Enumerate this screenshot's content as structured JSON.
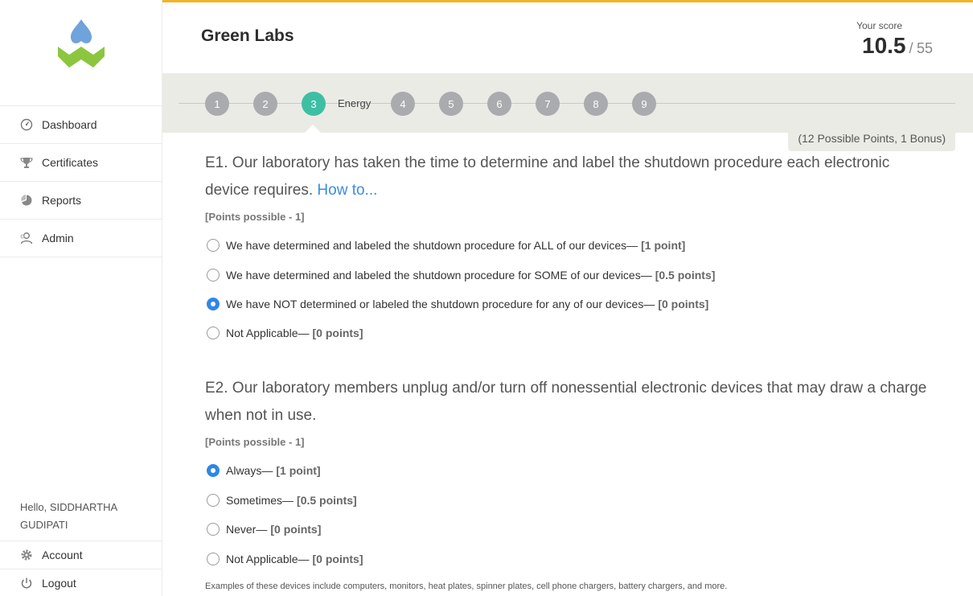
{
  "sidebar": {
    "nav": [
      {
        "label": "Dashboard",
        "icon": "dashboard-icon"
      },
      {
        "label": "Certificates",
        "icon": "trophy-icon"
      },
      {
        "label": "Reports",
        "icon": "pie-chart-icon"
      },
      {
        "label": "Admin",
        "icon": "users-icon"
      }
    ],
    "greeting_prefix": "Hello,",
    "user_name": "SIDDHARTHA GUDIPATI",
    "account_label": "Account",
    "logout_label": "Logout"
  },
  "header": {
    "title": "Green Labs",
    "score_label": "Your score",
    "score_value": "10.5",
    "score_separator": "/",
    "score_max": "55"
  },
  "steps": {
    "items": [
      "1",
      "2",
      "3",
      "4",
      "5",
      "6",
      "7",
      "8",
      "9"
    ],
    "active_index": 2,
    "active_label": "Energy"
  },
  "section": {
    "possible_points": "(12 Possible Points, 1 Bonus)"
  },
  "questions": [
    {
      "text": "E1. Our laboratory has taken the time to determine and label the shutdown procedure each electronic device requires.",
      "link": "How to...",
      "points_possible": "[Points possible - 1]",
      "options": [
        {
          "label": "We have determined and labeled the shutdown procedure for ALL of our devices—",
          "points": "[1 point]",
          "checked": false
        },
        {
          "label": "We have determined and labeled the shutdown procedure for SOME of our devices—",
          "points": "[0.5 points]",
          "checked": false
        },
        {
          "label": "We have NOT determined or labeled the shutdown procedure for any of our devices—",
          "points": "[0 points]",
          "checked": true
        },
        {
          "label": "Not Applicable—",
          "points": "[0 points]",
          "checked": false
        }
      ]
    },
    {
      "text": "E2. Our laboratory members unplug and/or turn off nonessential electronic devices that may draw a charge when not in use.",
      "points_possible": "[Points possible - 1]",
      "options": [
        {
          "label": "Always—",
          "points": "[1 point]",
          "checked": true
        },
        {
          "label": "Sometimes—",
          "points": "[0.5 points]",
          "checked": false
        },
        {
          "label": "Never—",
          "points": "[0 points]",
          "checked": false
        },
        {
          "label": "Not Applicable—",
          "points": "[0 points]",
          "checked": false
        }
      ],
      "note": "Examples of these devices include computers, monitors, heat plates, spinner plates, cell phone chargers, battery chargers, and more."
    }
  ],
  "colors": {
    "accent_top": "#f5b325",
    "step_active": "#3ebfa4",
    "step_inactive": "#a9abaf",
    "radio_checked": "#2f86e8",
    "link": "#3a8dde",
    "logo_blue": "#6fa3d9",
    "logo_green": "#8cc63f"
  }
}
